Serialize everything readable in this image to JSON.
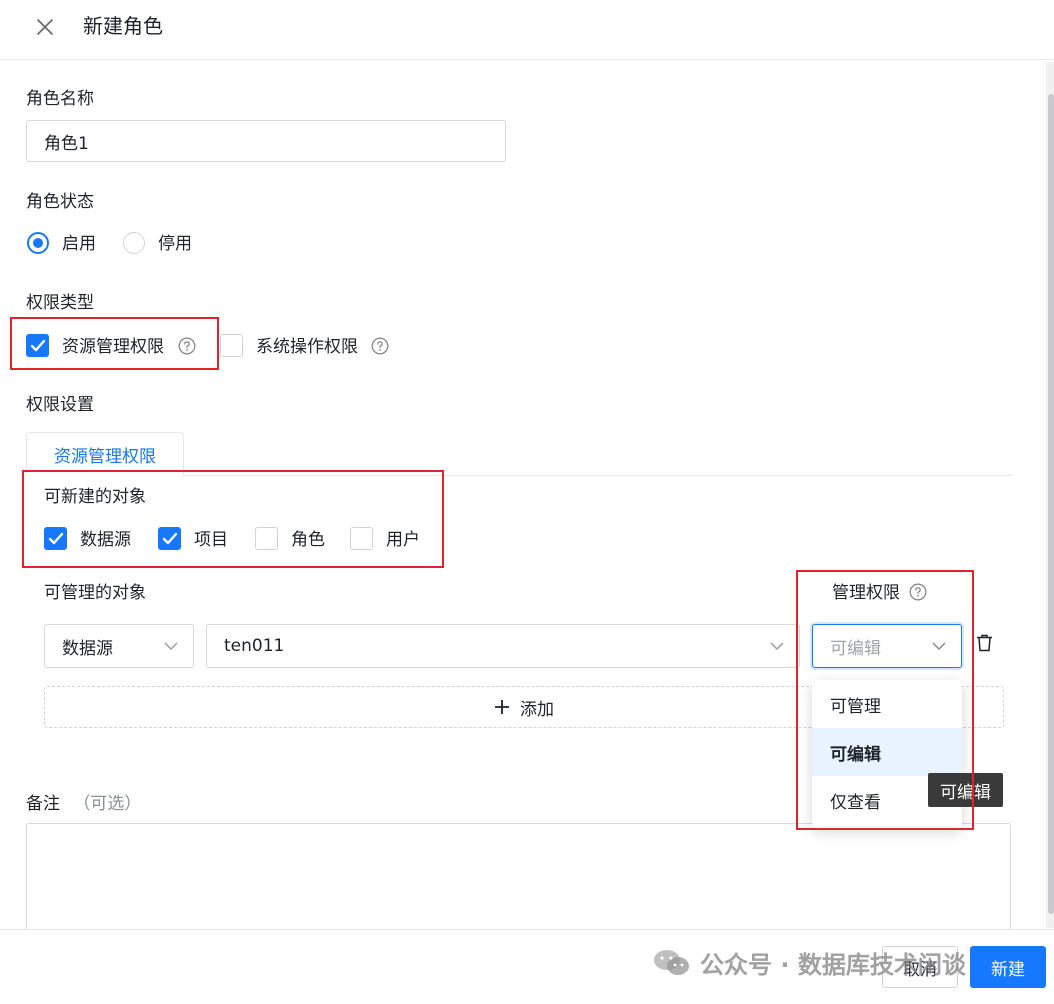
{
  "dialog": {
    "title": "新建角色"
  },
  "role_name": {
    "label": "角色名称",
    "value": "角色1"
  },
  "role_status": {
    "label": "角色状态",
    "options": [
      {
        "label": "启用",
        "checked": true
      },
      {
        "label": "停用",
        "checked": false
      }
    ]
  },
  "permission_type": {
    "label": "权限类型",
    "options": [
      {
        "label": "资源管理权限",
        "checked": true
      },
      {
        "label": "系统操作权限",
        "checked": false
      }
    ]
  },
  "permission_settings": {
    "label": "权限设置",
    "tab": "资源管理权限",
    "creatable": {
      "label": "可新建的对象",
      "options": [
        {
          "label": "数据源",
          "checked": true
        },
        {
          "label": "项目",
          "checked": true
        },
        {
          "label": "角色",
          "checked": false
        },
        {
          "label": "用户",
          "checked": false
        }
      ]
    },
    "manageable": {
      "label": "可管理的对象",
      "perm_label": "管理权限",
      "type_value": "数据源",
      "object_value": "ten011",
      "perm_value": "可编辑",
      "add_label": "添加"
    },
    "dropdown": {
      "options": [
        "可管理",
        "可编辑",
        "仅查看"
      ],
      "selected": "可编辑"
    },
    "tooltip": "可编辑"
  },
  "remark": {
    "label": "备注",
    "optional": "（可选）"
  },
  "footer": {
    "cancel": "取消",
    "create": "新建"
  },
  "watermark": {
    "text": "公众号 · 数据库技术闲谈"
  },
  "colors": {
    "accent": "#1677ff",
    "highlight": "#e0242b"
  }
}
